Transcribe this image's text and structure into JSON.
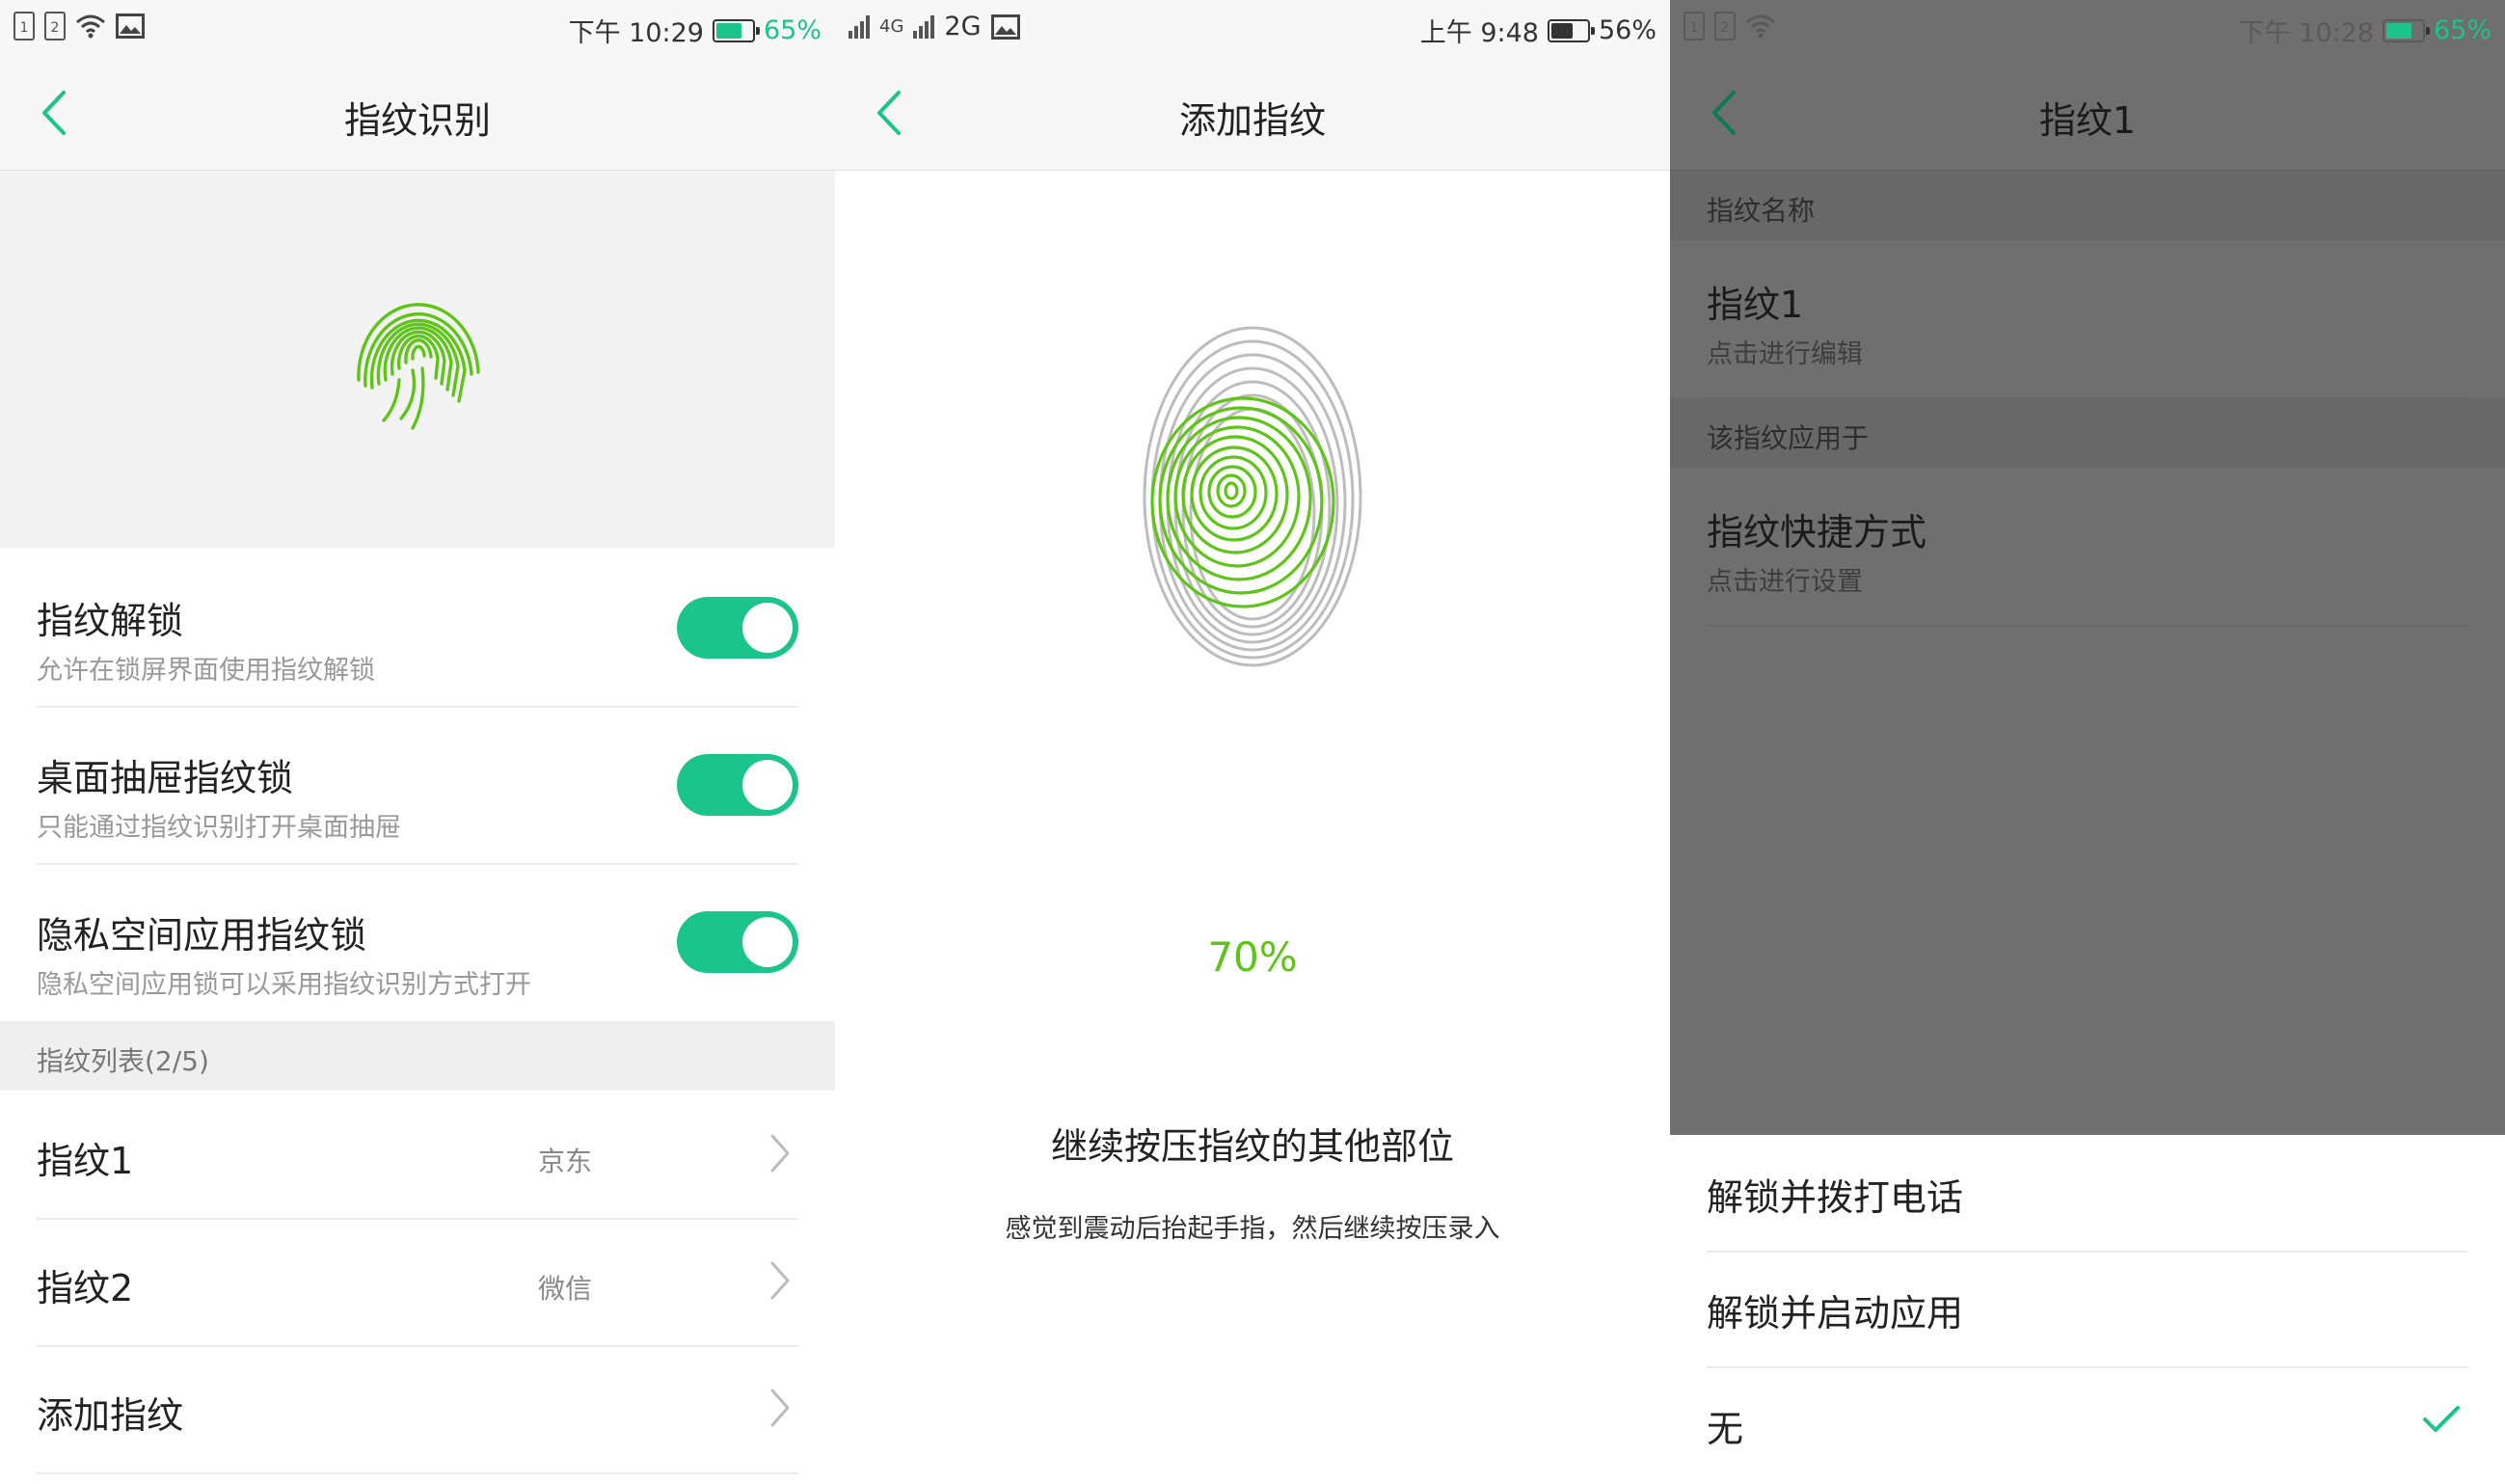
{
  "screen1": {
    "status": {
      "time": "下午 10:29",
      "battery": "65%",
      "battery_color": "#1bc48a",
      "battery_level": 0.65
    },
    "title": "指纹识别",
    "toggles": [
      {
        "title": "指纹解锁",
        "subtitle": "允许在锁屏界面使用指纹解锁",
        "on": true
      },
      {
        "title": "桌面抽屉指纹锁",
        "subtitle": "只能通过指纹识别打开桌面抽屉",
        "on": true
      },
      {
        "title": "隐私空间应用指纹锁",
        "subtitle": "隐私空间应用锁可以采用指纹识别方式打开",
        "on": true
      }
    ],
    "list_header": "指纹列表(2/5)",
    "list": [
      {
        "title": "指纹1",
        "value": "京东"
      },
      {
        "title": "指纹2",
        "value": "微信"
      },
      {
        "title": "添加指纹",
        "value": ""
      }
    ]
  },
  "screen2": {
    "status": {
      "net1": "4G",
      "net2": "2G",
      "time": "上午 9:48",
      "battery": "56%",
      "battery_level": 0.56
    },
    "title": "添加指纹",
    "progress": "70%",
    "progress_value": 0.7,
    "tip": "继续按压指纹的其他部位",
    "subtip": "感觉到震动后抬起手指，然后继续按压录入"
  },
  "screen3": {
    "status": {
      "time": "下午 10:28",
      "battery": "65%",
      "battery_level": 0.65
    },
    "title": "指纹1",
    "section_name": "指纹名称",
    "name_row": {
      "title": "指纹1",
      "subtitle": "点击进行编辑"
    },
    "section_apply": "该指纹应用于",
    "shortcut_row": {
      "title": "指纹快捷方式",
      "subtitle": "点击进行设置"
    },
    "options": [
      {
        "label": "解锁并拨打电话",
        "selected": false
      },
      {
        "label": "解锁并启动应用",
        "selected": false
      },
      {
        "label": "无",
        "selected": true
      }
    ]
  },
  "icons": {
    "back": "chevron-left-icon",
    "forward": "chevron-right-icon",
    "fingerprint": "fingerprint-icon",
    "check": "check-icon",
    "wifi": "wifi-icon",
    "image": "image-icon",
    "sim": "sim-card-icon",
    "signal": "signal-icon"
  },
  "colors": {
    "accent": "#1bc48a",
    "fingerprint_green": "#5ec418",
    "percent_green": "#5ec418"
  }
}
